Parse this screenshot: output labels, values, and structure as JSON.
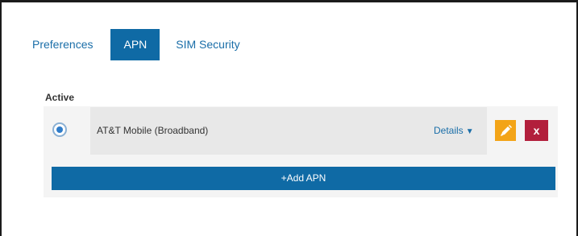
{
  "tabs": [
    {
      "label": "Preferences",
      "active": false
    },
    {
      "label": "APN",
      "active": true
    },
    {
      "label": "SIM Security",
      "active": false
    }
  ],
  "apn_section": {
    "heading": "Active",
    "entries": [
      {
        "name": "AT&T Mobile (Broadband)",
        "selected": true,
        "details_label": "Details",
        "details_caret": "▼",
        "delete_label": "x"
      }
    ],
    "add_button_label": "+Add APN"
  },
  "colors": {
    "accent": "#0f6aa5",
    "edit_button": "#f3a417",
    "delete_button": "#b21f3c"
  },
  "icons": {
    "edit": "pencil-icon",
    "delete": "close-icon",
    "details": "caret-down-icon"
  }
}
